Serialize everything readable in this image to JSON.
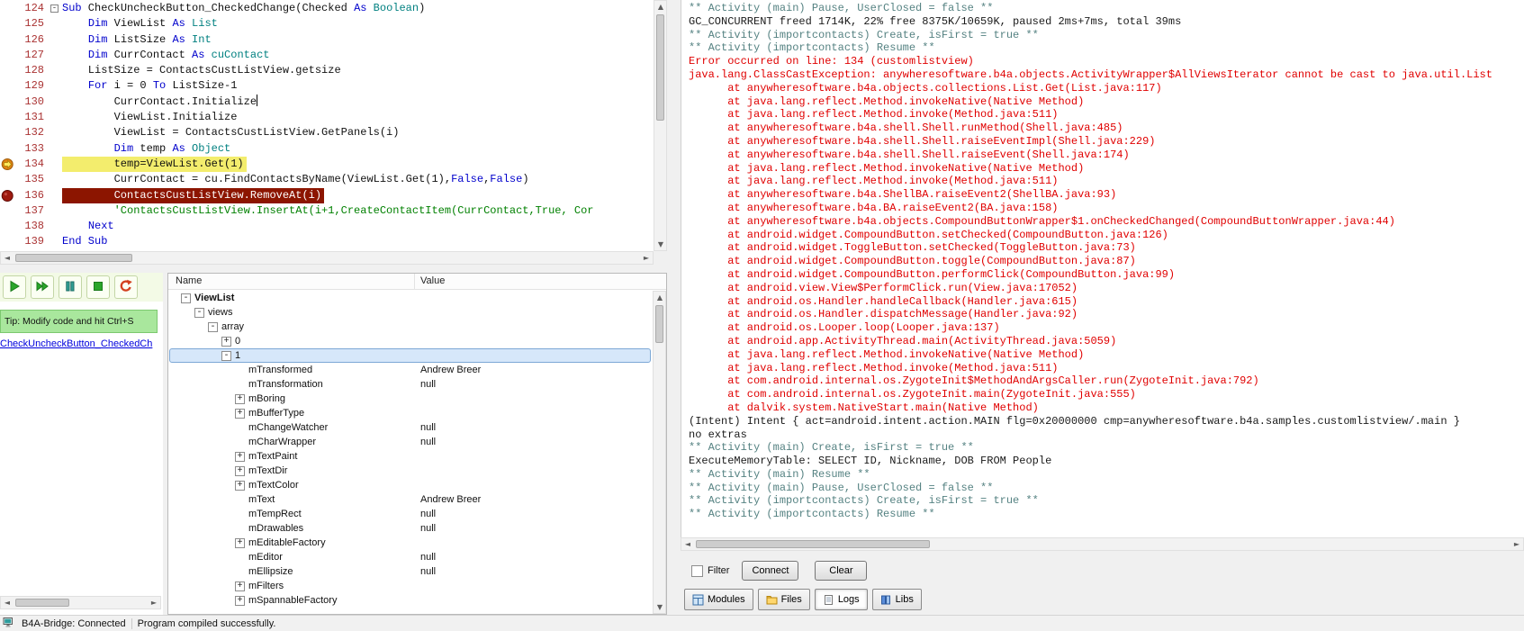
{
  "colors": {
    "keyword": "#0000cc",
    "type": "#008080",
    "comment": "#008000",
    "linenum": "#aa3333",
    "current-line-bg": "#f3ed6d",
    "breakpoint-line-bg": "#8c1500",
    "breakpoint-line-text": "#ffffff",
    "log-error": "#e00000",
    "log-activity": "#558282",
    "log-plain": "#1a1a1a",
    "selection-border": "#7da8d6",
    "selection-bg": "#d6e7fa",
    "link": "#0000dd",
    "tip-bg": "#a9e79d",
    "tip-border": "#7cc96f"
  },
  "editor": {
    "lines": [
      {
        "num": 124,
        "fold": "minus",
        "tokens": [
          [
            "kw",
            "Sub"
          ],
          [
            "pl",
            " CheckUncheckButton_CheckedChange(Checked "
          ],
          [
            "kw",
            "As"
          ],
          [
            "pl",
            " "
          ],
          [
            "ty",
            "Boolean"
          ],
          [
            "pl",
            ")"
          ]
        ]
      },
      {
        "num": 125,
        "tokens": [
          [
            "pl",
            "    "
          ],
          [
            "kw",
            "Dim"
          ],
          [
            "pl",
            " ViewList "
          ],
          [
            "kw",
            "As"
          ],
          [
            "pl",
            " "
          ],
          [
            "ty",
            "List"
          ]
        ]
      },
      {
        "num": 126,
        "tokens": [
          [
            "pl",
            "    "
          ],
          [
            "kw",
            "Dim"
          ],
          [
            "pl",
            " ListSize "
          ],
          [
            "kw",
            "As"
          ],
          [
            "pl",
            " "
          ],
          [
            "ty",
            "Int"
          ]
        ]
      },
      {
        "num": 127,
        "tokens": [
          [
            "pl",
            "    "
          ],
          [
            "kw",
            "Dim"
          ],
          [
            "pl",
            " CurrContact "
          ],
          [
            "kw",
            "As"
          ],
          [
            "pl",
            " "
          ],
          [
            "ty",
            "cuContact"
          ]
        ]
      },
      {
        "num": 128,
        "tokens": [
          [
            "pl",
            "    ListSize = ContactsCustListView.getsize"
          ]
        ]
      },
      {
        "num": 129,
        "tokens": [
          [
            "pl",
            "    "
          ],
          [
            "kw",
            "For"
          ],
          [
            "pl",
            " i = 0 "
          ],
          [
            "kw",
            "To"
          ],
          [
            "pl",
            " ListSize-1"
          ]
        ]
      },
      {
        "num": 130,
        "caret": true,
        "tokens": [
          [
            "pl",
            "        CurrContact.Initialize"
          ]
        ]
      },
      {
        "num": 131,
        "tokens": [
          [
            "pl",
            "        ViewList.Initialize"
          ]
        ]
      },
      {
        "num": 132,
        "tokens": [
          [
            "pl",
            "        ViewList = ContactsCustListView.GetPanels(i)"
          ]
        ]
      },
      {
        "num": 133,
        "tokens": [
          [
            "pl",
            "        "
          ],
          [
            "kw",
            "Dim"
          ],
          [
            "pl",
            " temp "
          ],
          [
            "kw",
            "As"
          ],
          [
            "pl",
            " "
          ],
          [
            "ty",
            "Object"
          ]
        ]
      },
      {
        "num": 134,
        "marker": "current-line",
        "hl": "current",
        "tokens": [
          [
            "pl",
            "        temp=ViewList.Get(1)"
          ]
        ]
      },
      {
        "num": 135,
        "tokens": [
          [
            "pl",
            "        CurrContact = cu.FindContactsByName(ViewList.Get(1),"
          ],
          [
            "kw",
            "False"
          ],
          [
            "pl",
            ","
          ],
          [
            "kw",
            "False"
          ],
          [
            "pl",
            ")"
          ]
        ]
      },
      {
        "num": 136,
        "marker": "breakpoint",
        "hl": "breakpoint",
        "tokens": [
          [
            "pl",
            "        ContactsCustListView.RemoveAt(i)"
          ]
        ]
      },
      {
        "num": 137,
        "tokens": [
          [
            "cm",
            "        'ContactsCustListView.InsertAt(i+1,CreateContactItem(CurrContact,True, Cor"
          ]
        ]
      },
      {
        "num": 138,
        "tokens": [
          [
            "pl",
            "    "
          ],
          [
            "kw",
            "Next"
          ]
        ]
      },
      {
        "num": 139,
        "tokens": [
          [
            "kw",
            "End Sub"
          ]
        ]
      }
    ]
  },
  "toolbar": {
    "buttons": [
      {
        "name": "run",
        "icon": "play-icon"
      },
      {
        "name": "run-to-cursor",
        "icon": "fast-forward-icon"
      },
      {
        "name": "pause",
        "icon": "pause-icon"
      },
      {
        "name": "stop",
        "icon": "stop-icon"
      },
      {
        "name": "restart",
        "icon": "restart-icon"
      }
    ]
  },
  "sidebar": {
    "tip": "Tip: Modify code and hit Ctrl+S",
    "event_link": "CheckUncheckButton_CheckedCh"
  },
  "watch": {
    "columns": [
      "Name",
      "Value"
    ],
    "rows": [
      {
        "name": "ViewList",
        "value": "",
        "indent": 0,
        "expander": "minus",
        "bold": true
      },
      {
        "name": "views",
        "value": "",
        "indent": 1,
        "expander": "minus"
      },
      {
        "name": "array",
        "value": "",
        "indent": 2,
        "expander": "minus"
      },
      {
        "name": "0",
        "value": "",
        "indent": 3,
        "expander": "plus"
      },
      {
        "name": "1",
        "value": "",
        "indent": 3,
        "expander": "minus",
        "selected": true
      },
      {
        "name": "mTransformed",
        "value": "Andrew Breer",
        "indent": 4
      },
      {
        "name": "mTransformation",
        "value": "null",
        "indent": 4
      },
      {
        "name": "mBoring",
        "value": "",
        "indent": 4,
        "expander": "plus"
      },
      {
        "name": "mBufferType",
        "value": "",
        "indent": 4,
        "expander": "plus"
      },
      {
        "name": "mChangeWatcher",
        "value": "null",
        "indent": 4
      },
      {
        "name": "mCharWrapper",
        "value": "null",
        "indent": 4
      },
      {
        "name": "mTextPaint",
        "value": "",
        "indent": 4,
        "expander": "plus"
      },
      {
        "name": "mTextDir",
        "value": "",
        "indent": 4,
        "expander": "plus"
      },
      {
        "name": "mTextColor",
        "value": "",
        "indent": 4,
        "expander": "plus"
      },
      {
        "name": "mText",
        "value": "Andrew Breer",
        "indent": 4
      },
      {
        "name": "mTempRect",
        "value": "null",
        "indent": 4
      },
      {
        "name": "mDrawables",
        "value": "null",
        "indent": 4
      },
      {
        "name": "mEditableFactory",
        "value": "",
        "indent": 4,
        "expander": "plus"
      },
      {
        "name": "mEditor",
        "value": "null",
        "indent": 4
      },
      {
        "name": "mEllipsize",
        "value": "null",
        "indent": 4
      },
      {
        "name": "mFilters",
        "value": "",
        "indent": 4,
        "expander": "plus"
      },
      {
        "name": "mSpannableFactory",
        "value": "",
        "indent": 4,
        "expander": "plus"
      }
    ]
  },
  "logs": {
    "lines": [
      {
        "c": "activity",
        "t": "** Activity (main) Pause, UserClosed = false **"
      },
      {
        "c": "plain",
        "t": "GC_CONCURRENT freed 1714K, 22% free 8375K/10659K, paused 2ms+7ms, total 39ms"
      },
      {
        "c": "activity",
        "t": "** Activity (importcontacts) Create, isFirst = true **"
      },
      {
        "c": "activity",
        "t": "** Activity (importcontacts) Resume **"
      },
      {
        "c": "error",
        "t": "Error occurred on line: 134 (customlistview)"
      },
      {
        "c": "error",
        "t": "java.lang.ClassCastException: anywheresoftware.b4a.objects.ActivityWrapper$AllViewsIterator cannot be cast to java.util.List"
      },
      {
        "c": "error",
        "t": "      at anywheresoftware.b4a.objects.collections.List.Get(List.java:117)"
      },
      {
        "c": "error",
        "t": "      at java.lang.reflect.Method.invokeNative(Native Method)"
      },
      {
        "c": "error",
        "t": "      at java.lang.reflect.Method.invoke(Method.java:511)"
      },
      {
        "c": "error",
        "t": "      at anywheresoftware.b4a.shell.Shell.runMethod(Shell.java:485)"
      },
      {
        "c": "error",
        "t": "      at anywheresoftware.b4a.shell.Shell.raiseEventImpl(Shell.java:229)"
      },
      {
        "c": "error",
        "t": "      at anywheresoftware.b4a.shell.Shell.raiseEvent(Shell.java:174)"
      },
      {
        "c": "error",
        "t": "      at java.lang.reflect.Method.invokeNative(Native Method)"
      },
      {
        "c": "error",
        "t": "      at java.lang.reflect.Method.invoke(Method.java:511)"
      },
      {
        "c": "error",
        "t": "      at anywheresoftware.b4a.ShellBA.raiseEvent2(ShellBA.java:93)"
      },
      {
        "c": "error",
        "t": "      at anywheresoftware.b4a.BA.raiseEvent2(BA.java:158)"
      },
      {
        "c": "error",
        "t": "      at anywheresoftware.b4a.objects.CompoundButtonWrapper$1.onCheckedChanged(CompoundButtonWrapper.java:44)"
      },
      {
        "c": "error",
        "t": "      at android.widget.CompoundButton.setChecked(CompoundButton.java:126)"
      },
      {
        "c": "error",
        "t": "      at android.widget.ToggleButton.setChecked(ToggleButton.java:73)"
      },
      {
        "c": "error",
        "t": "      at android.widget.CompoundButton.toggle(CompoundButton.java:87)"
      },
      {
        "c": "error",
        "t": "      at android.widget.CompoundButton.performClick(CompoundButton.java:99)"
      },
      {
        "c": "error",
        "t": "      at android.view.View$PerformClick.run(View.java:17052)"
      },
      {
        "c": "error",
        "t": "      at android.os.Handler.handleCallback(Handler.java:615)"
      },
      {
        "c": "error",
        "t": "      at android.os.Handler.dispatchMessage(Handler.java:92)"
      },
      {
        "c": "error",
        "t": "      at android.os.Looper.loop(Looper.java:137)"
      },
      {
        "c": "error",
        "t": "      at android.app.ActivityThread.main(ActivityThread.java:5059)"
      },
      {
        "c": "error",
        "t": "      at java.lang.reflect.Method.invokeNative(Native Method)"
      },
      {
        "c": "error",
        "t": "      at java.lang.reflect.Method.invoke(Method.java:511)"
      },
      {
        "c": "error",
        "t": "      at com.android.internal.os.ZygoteInit$MethodAndArgsCaller.run(ZygoteInit.java:792)"
      },
      {
        "c": "error",
        "t": "      at com.android.internal.os.ZygoteInit.main(ZygoteInit.java:555)"
      },
      {
        "c": "error",
        "t": "      at dalvik.system.NativeStart.main(Native Method)"
      },
      {
        "c": "plain",
        "t": "(Intent) Intent { act=android.intent.action.MAIN flg=0x20000000 cmp=anywheresoftware.b4a.samples.customlistview/.main }"
      },
      {
        "c": "plain",
        "t": "no extras"
      },
      {
        "c": "activity",
        "t": "** Activity (main) Create, isFirst = true **"
      },
      {
        "c": "plain",
        "t": "ExecuteMemoryTable: SELECT ID, Nickname, DOB FROM People"
      },
      {
        "c": "activity",
        "t": "** Activity (main) Resume **"
      },
      {
        "c": "activity",
        "t": "** Activity (main) Pause, UserClosed = false **"
      },
      {
        "c": "activity",
        "t": "** Activity (importcontacts) Create, isFirst = true **"
      },
      {
        "c": "activity",
        "t": "** Activity (importcontacts) Resume **"
      }
    ]
  },
  "filter": {
    "label": "Filter",
    "checked": false
  },
  "buttons": {
    "connect": "Connect",
    "clear": "Clear"
  },
  "tabs": [
    {
      "label": "Modules",
      "icon": "modules-icon",
      "selected": false
    },
    {
      "label": "Files",
      "icon": "files-icon",
      "selected": false
    },
    {
      "label": "Logs",
      "icon": "logs-icon",
      "selected": true
    },
    {
      "label": "Libs",
      "icon": "libs-icon",
      "selected": false
    }
  ],
  "statusbar": {
    "bridge": "B4A-Bridge: Connected",
    "message": "Program compiled successfully."
  }
}
